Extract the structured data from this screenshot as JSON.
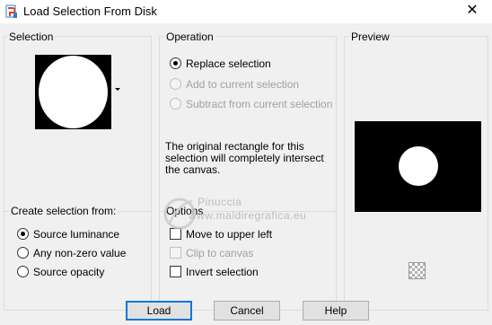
{
  "window": {
    "title": "Load Selection From Disk",
    "close_glyph": "✕"
  },
  "selection": {
    "label": "Selection"
  },
  "operation": {
    "label": "Operation",
    "options": [
      {
        "label": "Replace selection",
        "checked": true,
        "enabled": true
      },
      {
        "label": "Add to current selection",
        "checked": false,
        "enabled": false
      },
      {
        "label": "Subtract from current selection",
        "checked": false,
        "enabled": false
      }
    ],
    "description": "The original rectangle for this selection will completely intersect the canvas."
  },
  "preview": {
    "label": "Preview"
  },
  "create_from": {
    "label": "Create selection from:",
    "options": [
      {
        "label": "Source luminance",
        "checked": true
      },
      {
        "label": "Any non-zero value",
        "checked": false
      },
      {
        "label": "Source opacity",
        "checked": false
      }
    ]
  },
  "options": {
    "label": "Options",
    "items": [
      {
        "label": "Move to upper left",
        "checked": false,
        "enabled": true
      },
      {
        "label": "Clip to canvas",
        "checked": false,
        "enabled": false
      },
      {
        "label": "Invert selection",
        "checked": false,
        "enabled": true
      }
    ]
  },
  "watermark": {
    "line1": "Pinuccia",
    "line2": "www.maldiregrafica.eu"
  },
  "buttons": {
    "load": "Load",
    "cancel": "Cancel",
    "help": "Help"
  },
  "icons": {
    "app": "psp-app-icon",
    "dropdown": "triangle-down-icon",
    "checker": "checkerboard-icon"
  }
}
